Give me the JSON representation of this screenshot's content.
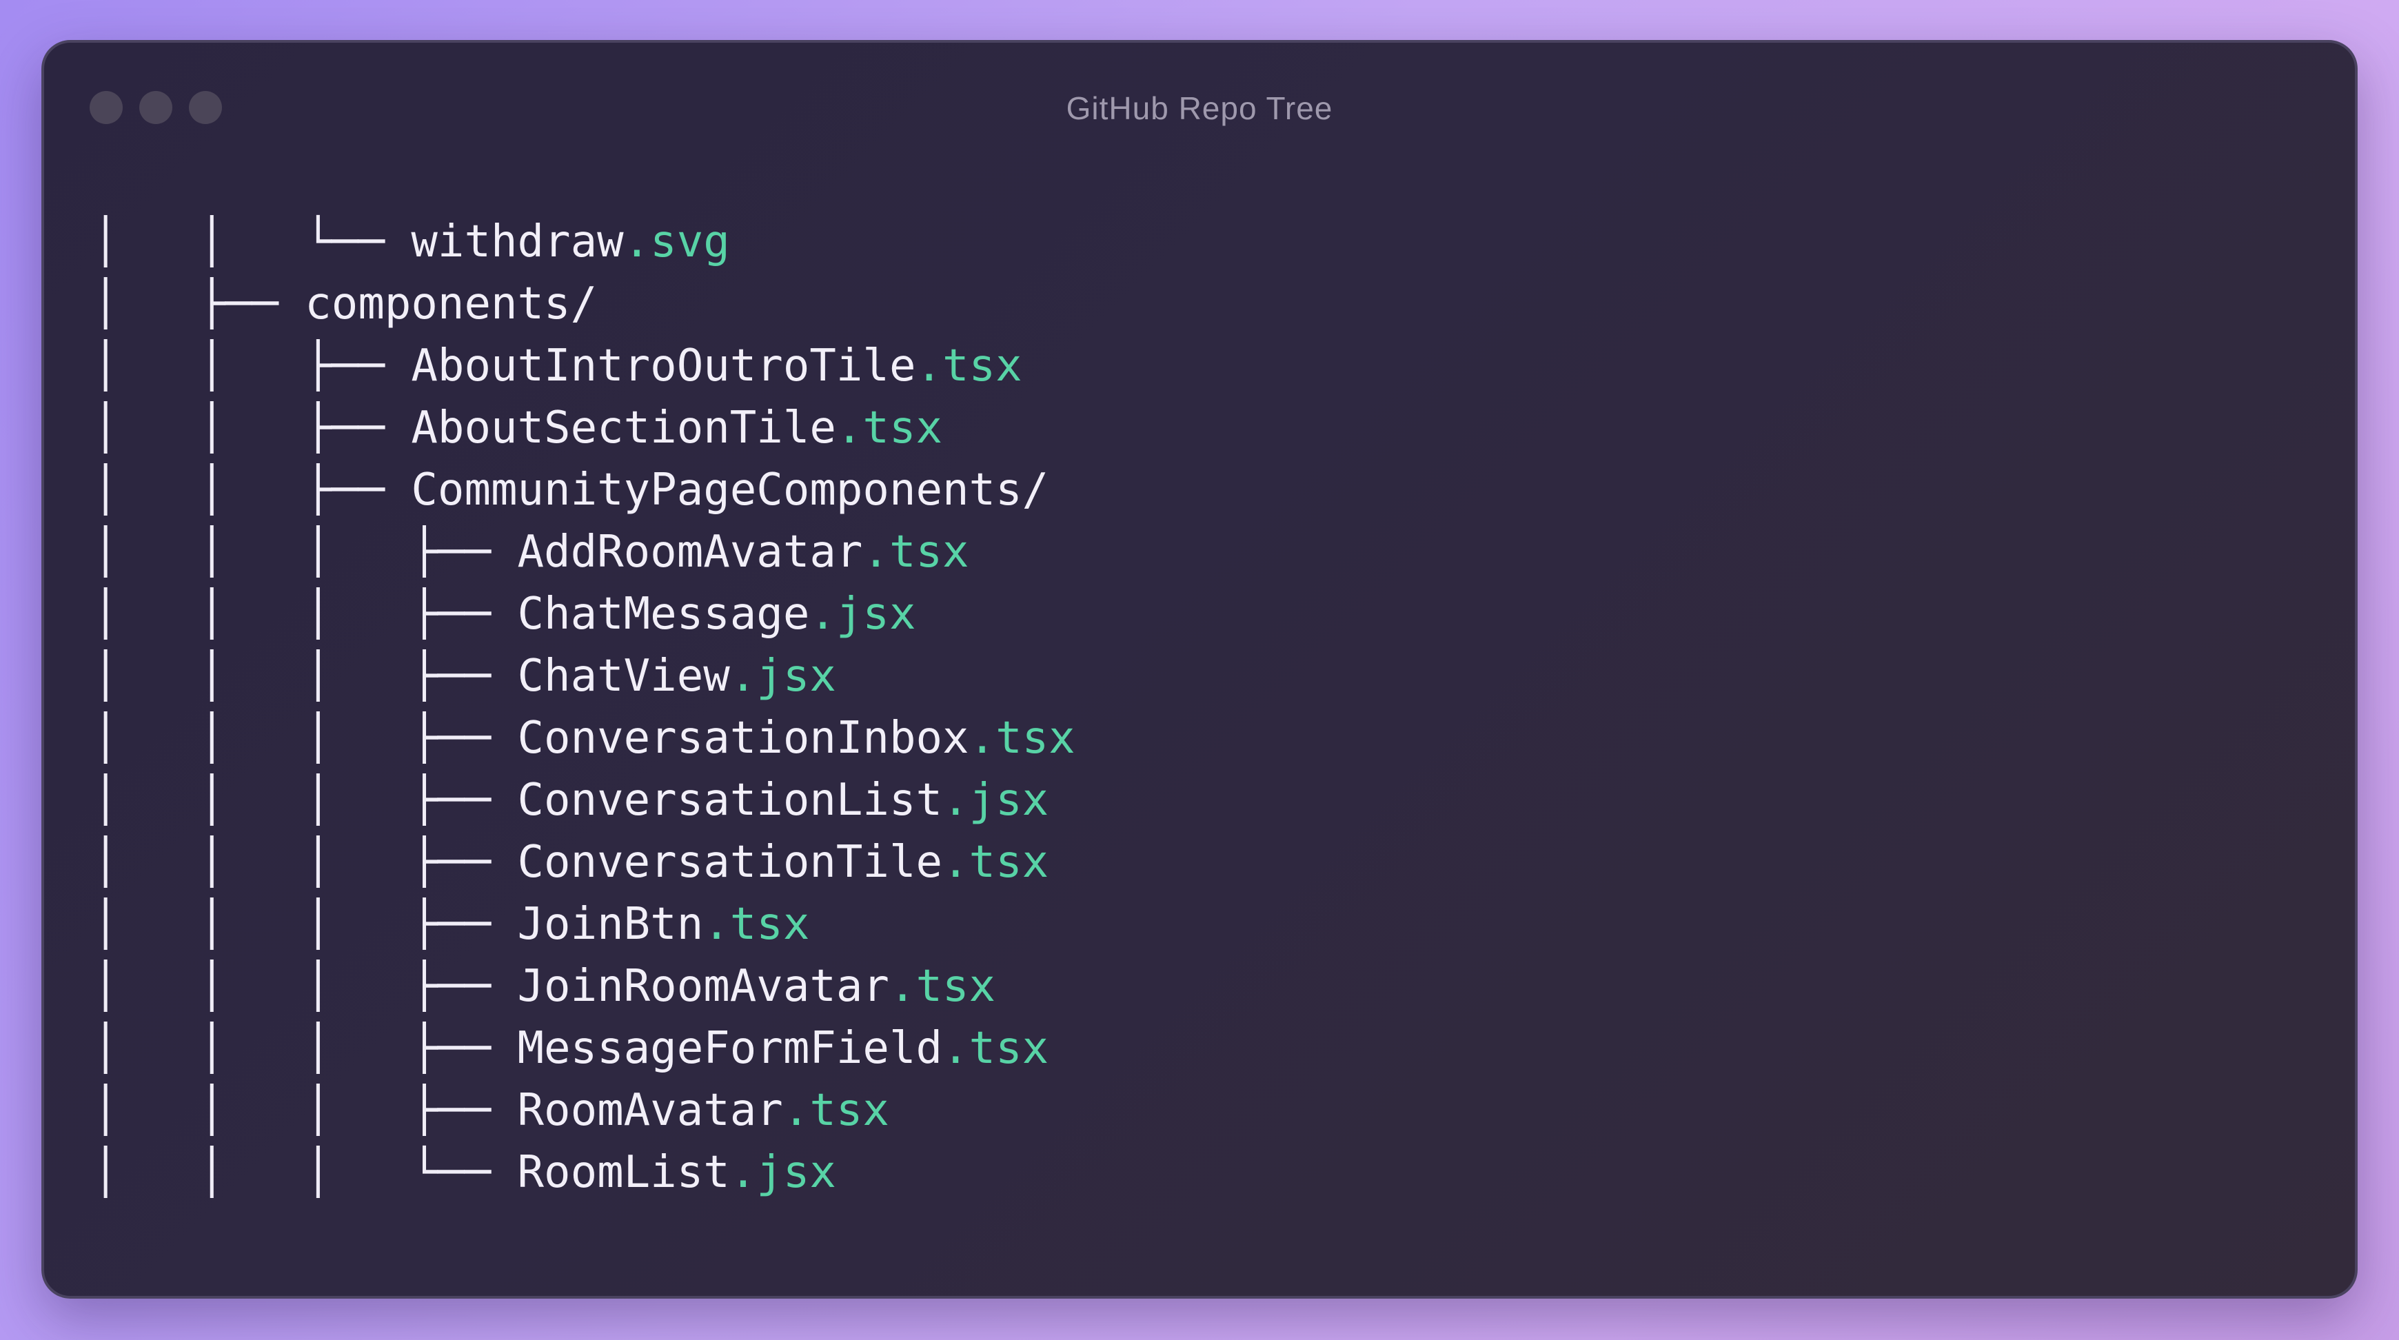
{
  "window": {
    "title": "GitHub Repo Tree"
  },
  "colors": {
    "extension": "#58d3a6",
    "text": "#f2eff8",
    "window_bg": "#2b2540"
  },
  "tree": {
    "rows": [
      {
        "guides": "│   │   └── ",
        "name": "withdraw",
        "ext": ".svg"
      },
      {
        "guides": "│   ├── ",
        "name": "components/",
        "ext": ""
      },
      {
        "guides": "│   │   ├── ",
        "name": "AboutIntroOutroTile",
        "ext": ".tsx"
      },
      {
        "guides": "│   │   ├── ",
        "name": "AboutSectionTile",
        "ext": ".tsx"
      },
      {
        "guides": "│   │   ├── ",
        "name": "CommunityPageComponents/",
        "ext": ""
      },
      {
        "guides": "│   │   │   ├── ",
        "name": "AddRoomAvatar",
        "ext": ".tsx"
      },
      {
        "guides": "│   │   │   ├── ",
        "name": "ChatMessage",
        "ext": ".jsx"
      },
      {
        "guides": "│   │   │   ├── ",
        "name": "ChatView",
        "ext": ".jsx"
      },
      {
        "guides": "│   │   │   ├── ",
        "name": "ConversationInbox",
        "ext": ".tsx"
      },
      {
        "guides": "│   │   │   ├── ",
        "name": "ConversationList",
        "ext": ".jsx"
      },
      {
        "guides": "│   │   │   ├── ",
        "name": "ConversationTile",
        "ext": ".tsx"
      },
      {
        "guides": "│   │   │   ├── ",
        "name": "JoinBtn",
        "ext": ".tsx"
      },
      {
        "guides": "│   │   │   ├── ",
        "name": "JoinRoomAvatar",
        "ext": ".tsx"
      },
      {
        "guides": "│   │   │   ├── ",
        "name": "MessageFormField",
        "ext": ".tsx"
      },
      {
        "guides": "│   │   │   ├── ",
        "name": "RoomAvatar",
        "ext": ".tsx"
      },
      {
        "guides": "│   │   │   └── ",
        "name": "RoomList",
        "ext": ".jsx"
      }
    ]
  }
}
